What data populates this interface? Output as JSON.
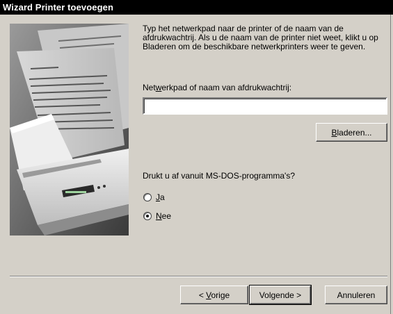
{
  "window": {
    "title": "Wizard Printer toevoegen"
  },
  "intro": {
    "text": "Typ het netwerkpad naar de printer of de naam van de afdrukwachtrij. Als u de naam van de printer niet weet, klikt u op Bladeren om de beschikbare netwerkprinters weer te geven."
  },
  "path_field": {
    "label_before": "Net",
    "label_accel": "w",
    "label_after": "erkpad of naam van afdrukwachtrij:",
    "value": ""
  },
  "browse_button": {
    "accel": "B",
    "rest": "laderen..."
  },
  "msdos": {
    "question": "Drukt u af vanuit MS-DOS-programma's?",
    "options": [
      {
        "accel": "J",
        "rest": "a",
        "selected": false
      },
      {
        "accel": "N",
        "rest": "ee",
        "selected": true
      }
    ]
  },
  "footer": {
    "back_prefix": "< ",
    "back_accel": "V",
    "back_rest": "orige",
    "next_label": "Volgende >",
    "cancel_label": "Annuleren"
  },
  "colors": {
    "face": "#d4d0c8",
    "titlebar": "#000000",
    "title_text": "#ffffff"
  },
  "icons": {
    "illustration": "printer-printing-pages-illustration"
  }
}
